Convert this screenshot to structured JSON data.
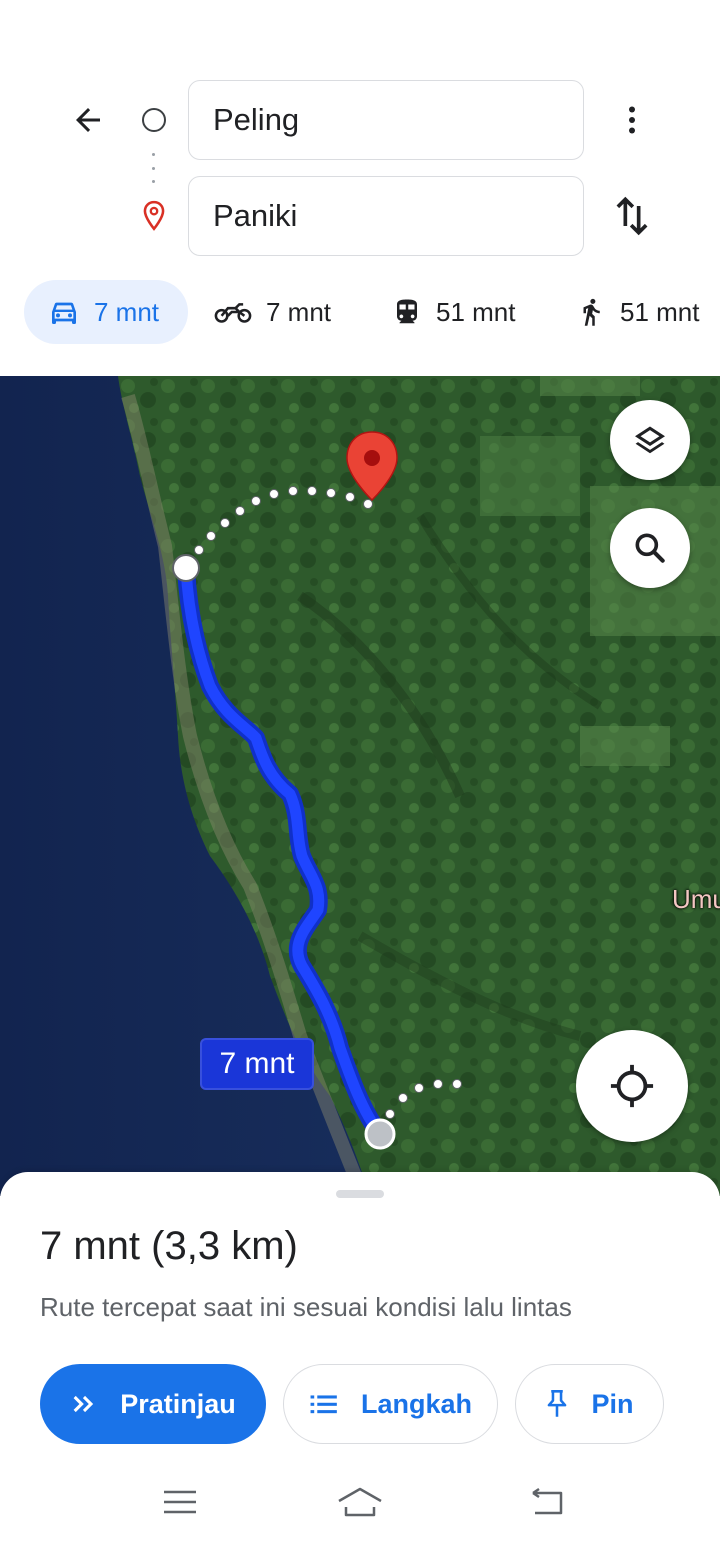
{
  "directions": {
    "origin_value": "Peling",
    "destination_value": "Paniki"
  },
  "icons": {
    "back": "arrow-back-icon",
    "origin": "origin-circle-icon",
    "destination": "destination-pin-icon",
    "more": "more-vert-icon",
    "swap": "swap-vert-icon",
    "layers": "layers-icon",
    "search": "search-icon",
    "locate": "my-location-icon"
  },
  "modes": [
    {
      "icon": "car-icon",
      "label": "7 mnt",
      "selected": true
    },
    {
      "icon": "motorcycle-icon",
      "label": "7 mnt",
      "selected": false
    },
    {
      "icon": "train-icon",
      "label": "51 mnt",
      "selected": false
    },
    {
      "icon": "walk-icon",
      "label": "51 mnt",
      "selected": false
    }
  ],
  "map": {
    "route_eta_label": "7 mnt",
    "place_label": "Umu",
    "route_color": "#1a36f0"
  },
  "sheet": {
    "summary": "7 mnt (3,3 km)",
    "subtitle": "Rute tercepat saat ini sesuai kondisi lalu lintas",
    "preview_label": "Pratinjau",
    "steps_label": "Langkah",
    "pin_label": "Pin"
  },
  "colors": {
    "accent": "#1a73e8",
    "active_chip_bg": "#e8f0fe",
    "pin_red": "#ea4335"
  },
  "system_nav": [
    "menu-icon",
    "home-icon",
    "back-icon"
  ]
}
